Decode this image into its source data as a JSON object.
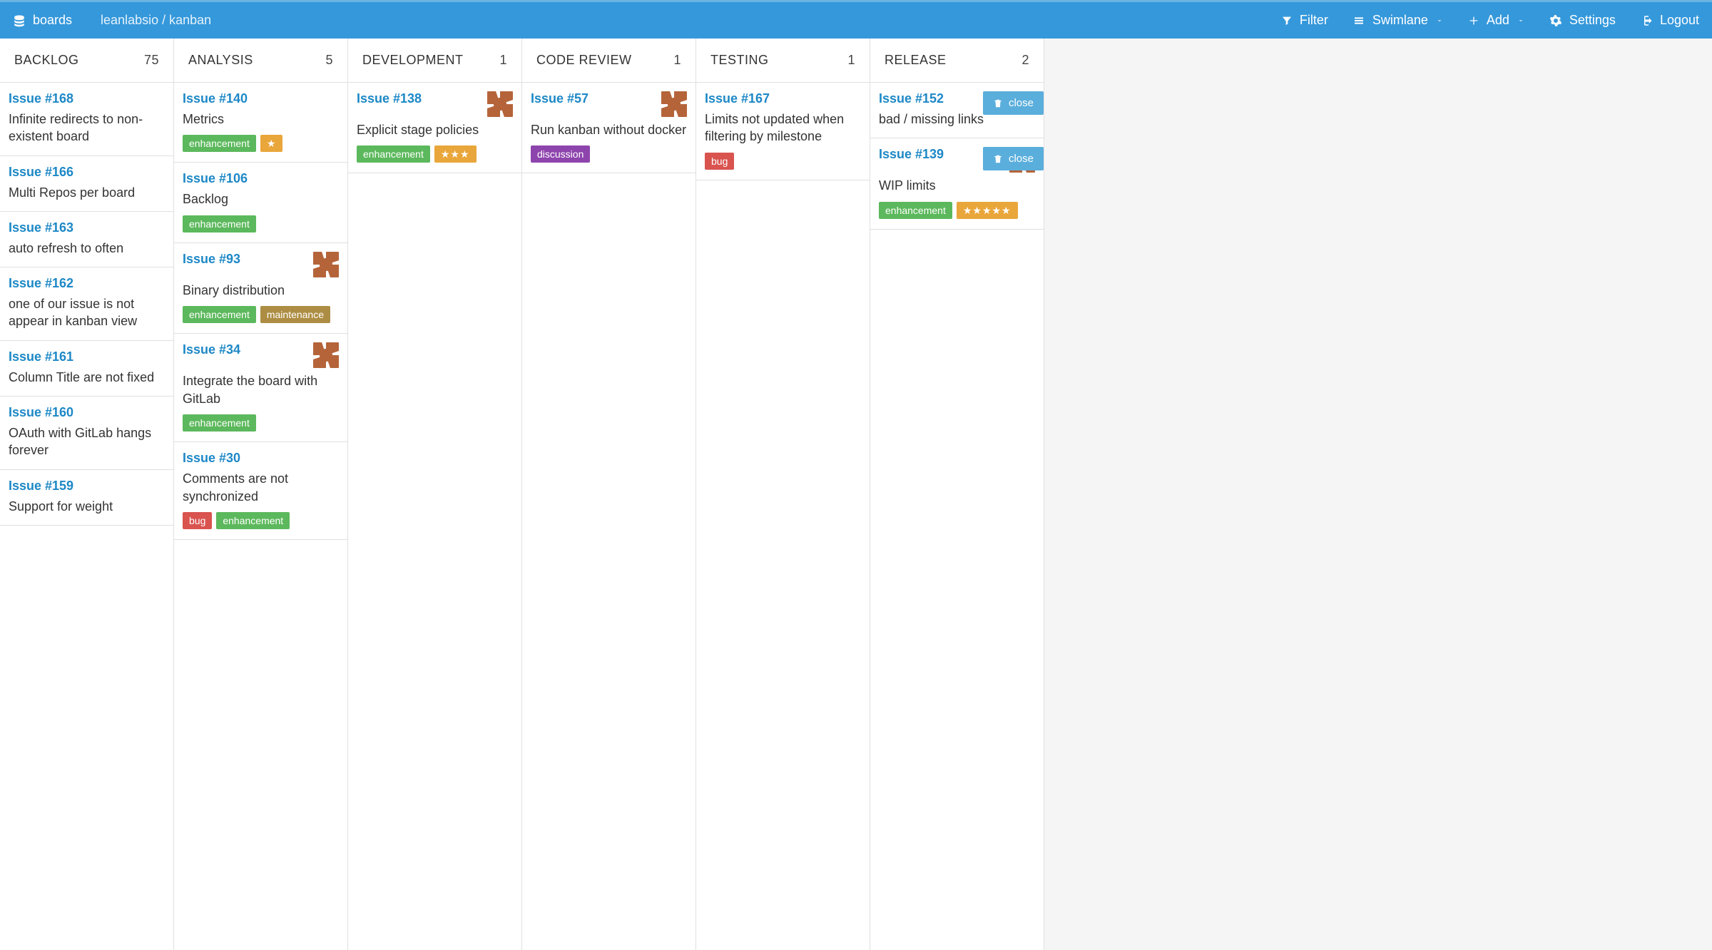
{
  "topbar": {
    "brand": "boards",
    "breadcrumb": "leanlabsio / kanban",
    "filter": "Filter",
    "swimlane": "Swimlane",
    "add": "Add",
    "settings": "Settings",
    "logout": "Logout"
  },
  "labels": {
    "enhancement": "enhancement",
    "maintenance": "maintenance",
    "bug": "bug",
    "discussion": "discussion"
  },
  "close_label": "close",
  "columns": [
    {
      "title": "BACKLOG",
      "count": 75,
      "cards": [
        {
          "id": "Issue #168",
          "title": "Infinite redirects to non-existent board"
        },
        {
          "id": "Issue #166",
          "title": "Multi Repos per board"
        },
        {
          "id": "Issue #163",
          "title": "auto refresh to often"
        },
        {
          "id": "Issue #162",
          "title": "one of our issue is not appear in kanban view"
        },
        {
          "id": "Issue #161",
          "title": "Column Title are not fixed"
        },
        {
          "id": "Issue #160",
          "title": "OAuth with GitLab hangs forever"
        },
        {
          "id": "Issue #159",
          "title": "Support for weight"
        }
      ]
    },
    {
      "title": "ANALYSIS",
      "count": 5,
      "cards": [
        {
          "id": "Issue #140",
          "title": "Metrics",
          "labels": [
            "enhancement"
          ],
          "stars": 1
        },
        {
          "id": "Issue #106",
          "title": "Backlog",
          "labels": [
            "enhancement"
          ]
        },
        {
          "id": "Issue #93",
          "title": "Binary distribution",
          "labels": [
            "enhancement",
            "maintenance"
          ],
          "avatar": true
        },
        {
          "id": "Issue #34",
          "title": "Integrate the board with GitLab",
          "labels": [
            "enhancement"
          ],
          "avatar": true
        },
        {
          "id": "Issue #30",
          "title": "Comments are not synchronized",
          "labels": [
            "bug",
            "enhancement"
          ]
        }
      ]
    },
    {
      "title": "DEVELOPMENT",
      "count": 1,
      "cards": [
        {
          "id": "Issue #138",
          "title": "Explicit stage policies",
          "labels": [
            "enhancement"
          ],
          "stars": 3,
          "avatar": true
        }
      ]
    },
    {
      "title": "CODE REVIEW",
      "count": 1,
      "cards": [
        {
          "id": "Issue #57",
          "title": "Run kanban without docker",
          "labels": [
            "discussion"
          ],
          "avatar": true
        }
      ]
    },
    {
      "title": "TESTING",
      "count": 1,
      "cards": [
        {
          "id": "Issue #167",
          "title": "Limits not updated when filtering by milestone",
          "labels": [
            "bug"
          ]
        }
      ]
    },
    {
      "title": "RELEASE",
      "count": 2,
      "cards": [
        {
          "id": "Issue #152",
          "title": "bad / missing links",
          "close": true
        },
        {
          "id": "Issue #139",
          "title": "WIP limits",
          "labels": [
            "enhancement"
          ],
          "stars": 5,
          "avatar": true,
          "close": true
        }
      ]
    }
  ]
}
